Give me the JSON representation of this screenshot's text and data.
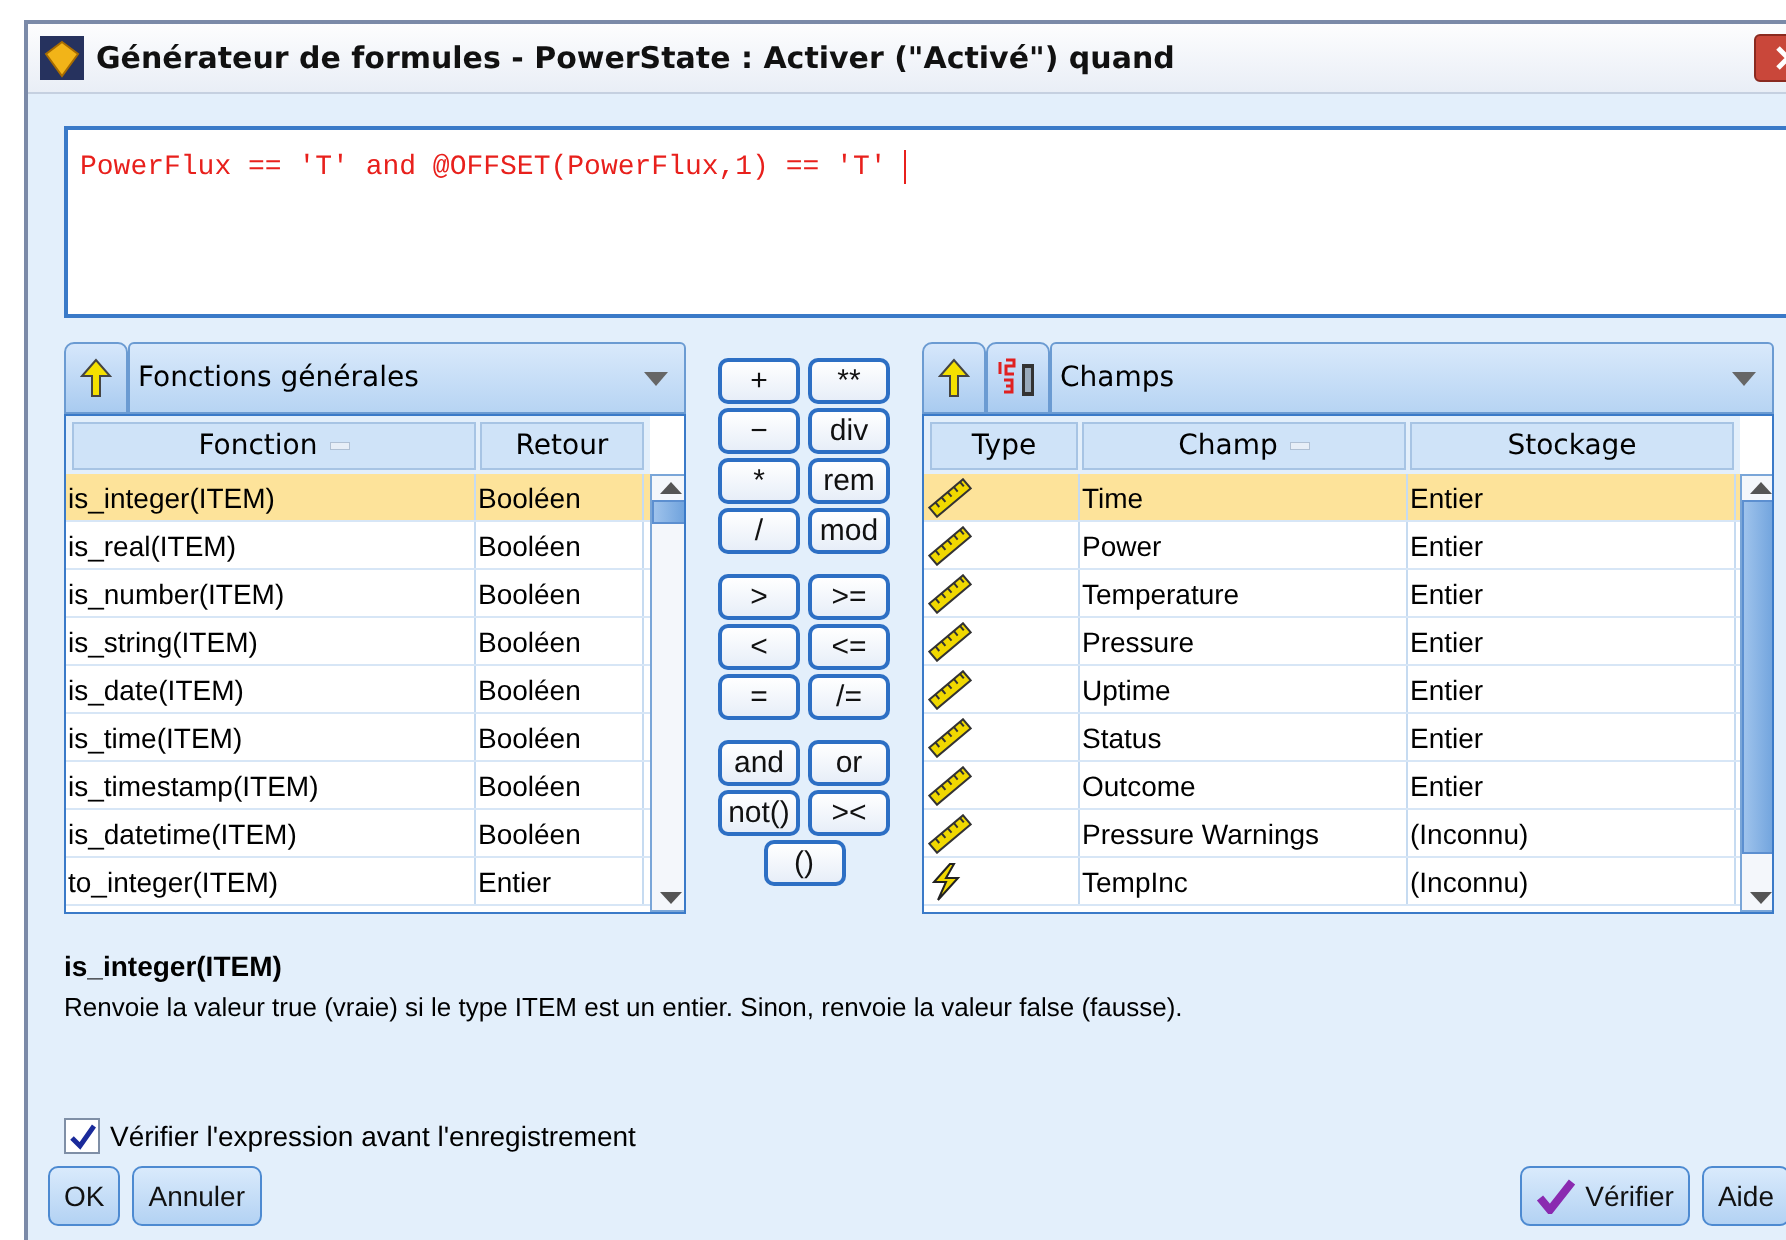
{
  "window": {
    "title": "Générateur de formules - PowerState : Activer (\"Activé\") quand"
  },
  "expression": {
    "value": "PowerFlux == 'T' and @OFFSET(PowerFlux,1) == 'T' "
  },
  "functions": {
    "category": "Fonctions générales",
    "columns": [
      {
        "label": "Fonction",
        "sorted": true
      },
      {
        "label": "Retour",
        "sorted": false
      }
    ],
    "rows": [
      {
        "name": "is_integer(ITEM)",
        "returns": "Booléen",
        "selected": true
      },
      {
        "name": "is_real(ITEM)",
        "returns": "Booléen",
        "selected": false
      },
      {
        "name": "is_number(ITEM)",
        "returns": "Booléen",
        "selected": false
      },
      {
        "name": "is_string(ITEM)",
        "returns": "Booléen",
        "selected": false
      },
      {
        "name": "is_date(ITEM)",
        "returns": "Booléen",
        "selected": false
      },
      {
        "name": "is_time(ITEM)",
        "returns": "Booléen",
        "selected": false
      },
      {
        "name": "is_timestamp(ITEM)",
        "returns": "Booléen",
        "selected": false
      },
      {
        "name": "is_datetime(ITEM)",
        "returns": "Booléen",
        "selected": false
      },
      {
        "name": "to_integer(ITEM)",
        "returns": "Entier",
        "selected": false
      }
    ]
  },
  "operators": [
    [
      [
        "+",
        "**"
      ],
      [
        "−",
        "div"
      ],
      [
        "*",
        "rem"
      ],
      [
        "/",
        "mod"
      ]
    ],
    [
      [
        ">",
        ">="
      ],
      [
        "<",
        "<="
      ],
      [
        "=",
        "/="
      ]
    ],
    [
      [
        "and",
        "or"
      ],
      [
        "not()",
        "><"
      ],
      [
        "()"
      ]
    ]
  ],
  "fields": {
    "category": "Champs",
    "columns": [
      {
        "label": "Type",
        "sorted": false
      },
      {
        "label": "Champ",
        "sorted": true
      },
      {
        "label": "Stockage",
        "sorted": false
      }
    ],
    "rows": [
      {
        "kind": "range",
        "name": "Time",
        "storage": "Entier",
        "selected": true
      },
      {
        "kind": "range",
        "name": "Power",
        "storage": "Entier",
        "selected": false
      },
      {
        "kind": "range",
        "name": "Temperature",
        "storage": "Entier",
        "selected": false
      },
      {
        "kind": "range",
        "name": "Pressure",
        "storage": "Entier",
        "selected": false
      },
      {
        "kind": "range",
        "name": "Uptime",
        "storage": "Entier",
        "selected": false
      },
      {
        "kind": "range",
        "name": "Status",
        "storage": "Entier",
        "selected": false
      },
      {
        "kind": "range",
        "name": "Outcome",
        "storage": "Entier",
        "selected": false
      },
      {
        "kind": "range",
        "name": "Pressure Warnings",
        "storage": "(Inconnu)",
        "selected": false
      },
      {
        "kind": "flag",
        "name": "TempInc",
        "storage": "(Inconnu)",
        "selected": false
      }
    ]
  },
  "description": {
    "title": "is_integer(ITEM)",
    "text": "Renvoie la valeur true (vraie) si le type ITEM est un entier. Sinon, renvoie la valeur false (fausse)."
  },
  "check_option": {
    "label": "Vérifier l'expression avant l'enregistrement",
    "checked": true
  },
  "buttons": {
    "left": [
      "OK",
      "Annuler"
    ],
    "verify": "Vérifier",
    "help": "Aide"
  }
}
